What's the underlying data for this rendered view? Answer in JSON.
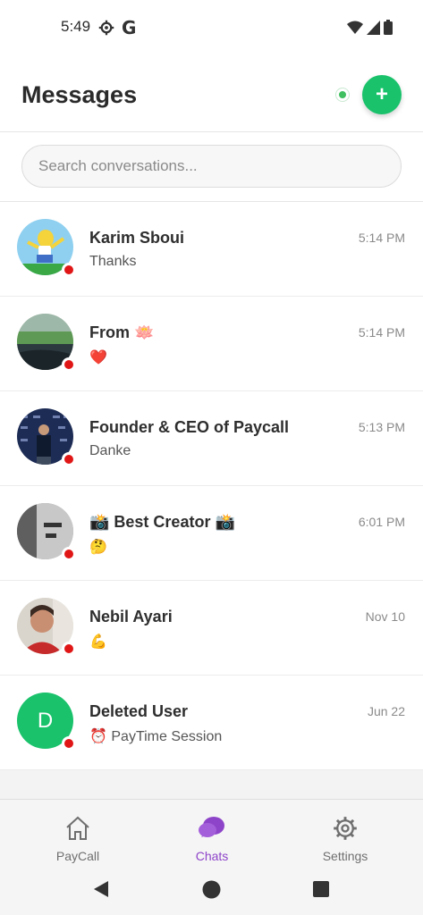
{
  "status_bar": {
    "time": "5:49",
    "g_label": "G"
  },
  "header": {
    "title": "Messages",
    "new_chat_label": "+"
  },
  "search": {
    "placeholder": "Search conversations..."
  },
  "conversations": [
    {
      "name": "Karim Sboui",
      "message": "Thanks",
      "time": "5:14 PM"
    },
    {
      "name": "From 🪷",
      "message": "❤️",
      "time": "5:14 PM"
    },
    {
      "name": "Founder & CEO of Paycall",
      "message": "Danke",
      "time": "5:13 PM"
    },
    {
      "name": "📸 Best Creator 📸",
      "message": "🤔",
      "time": "6:01 PM"
    },
    {
      "name": "Nebil Ayari",
      "message": "💪",
      "time": "Nov 10"
    },
    {
      "name": "Deleted User",
      "message": "⏰ PayTime Session",
      "time": "Jun 22",
      "initial": "D"
    }
  ],
  "bottom_nav": {
    "items": [
      {
        "label": "PayCall",
        "icon": "home-icon"
      },
      {
        "label": "Chats",
        "icon": "chat-bubbles-icon"
      },
      {
        "label": "Settings",
        "icon": "gear-icon"
      }
    ]
  },
  "colors": {
    "accent_green": "#19c26b",
    "active_purple": "#8e44c9",
    "unread_red": "#e01616"
  }
}
